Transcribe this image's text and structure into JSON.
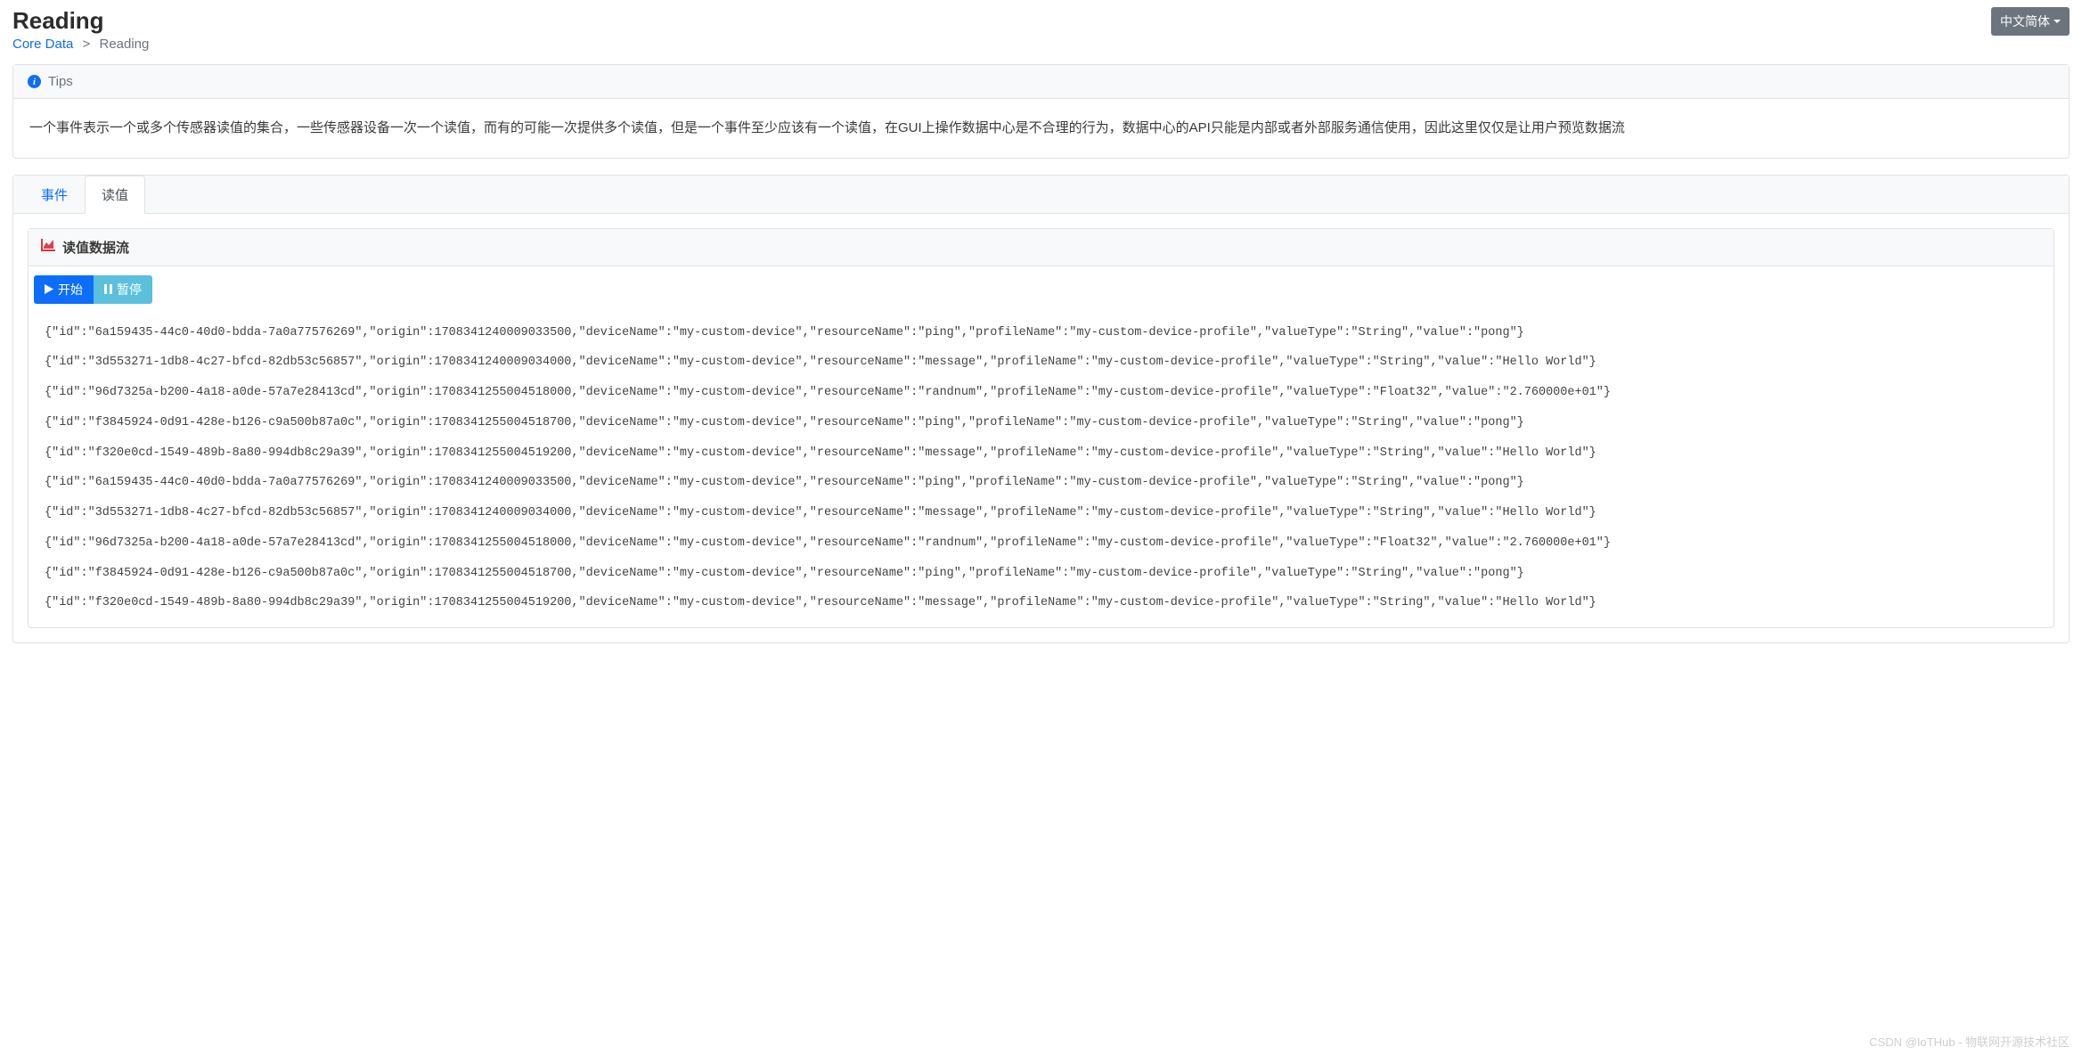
{
  "header": {
    "title": "Reading",
    "breadcrumb_root": "Core Data",
    "breadcrumb_current": "Reading",
    "lang_button": "中文简体"
  },
  "tips": {
    "label": "Tips",
    "body": "一个事件表示一个或多个传感器读值的集合，一些传感器设备一次一个读值，而有的可能一次提供多个读值，但是一个事件至少应该有一个读值，在GUI上操作数据中心是不合理的行为，数据中心的API只能是内部或者外部服务通信使用，因此这里仅仅是让用户预览数据流"
  },
  "tabs": {
    "event": "事件",
    "reading": "读值"
  },
  "panel": {
    "title": "读值数据流",
    "start": "开始",
    "pause": "暂停"
  },
  "stream": [
    "{\"id\":\"6a159435-44c0-40d0-bdda-7a0a77576269\",\"origin\":1708341240009033500,\"deviceName\":\"my-custom-device\",\"resourceName\":\"ping\",\"profileName\":\"my-custom-device-profile\",\"valueType\":\"String\",\"value\":\"pong\"}",
    "{\"id\":\"3d553271-1db8-4c27-bfcd-82db53c56857\",\"origin\":1708341240009034000,\"deviceName\":\"my-custom-device\",\"resourceName\":\"message\",\"profileName\":\"my-custom-device-profile\",\"valueType\":\"String\",\"value\":\"Hello World\"}",
    "{\"id\":\"96d7325a-b200-4a18-a0de-57a7e28413cd\",\"origin\":1708341255004518000,\"deviceName\":\"my-custom-device\",\"resourceName\":\"randnum\",\"profileName\":\"my-custom-device-profile\",\"valueType\":\"Float32\",\"value\":\"2.760000e+01\"}",
    "{\"id\":\"f3845924-0d91-428e-b126-c9a500b87a0c\",\"origin\":1708341255004518700,\"deviceName\":\"my-custom-device\",\"resourceName\":\"ping\",\"profileName\":\"my-custom-device-profile\",\"valueType\":\"String\",\"value\":\"pong\"}",
    "{\"id\":\"f320e0cd-1549-489b-8a80-994db8c29a39\",\"origin\":1708341255004519200,\"deviceName\":\"my-custom-device\",\"resourceName\":\"message\",\"profileName\":\"my-custom-device-profile\",\"valueType\":\"String\",\"value\":\"Hello World\"}",
    "{\"id\":\"6a159435-44c0-40d0-bdda-7a0a77576269\",\"origin\":1708341240009033500,\"deviceName\":\"my-custom-device\",\"resourceName\":\"ping\",\"profileName\":\"my-custom-device-profile\",\"valueType\":\"String\",\"value\":\"pong\"}",
    "{\"id\":\"3d553271-1db8-4c27-bfcd-82db53c56857\",\"origin\":1708341240009034000,\"deviceName\":\"my-custom-device\",\"resourceName\":\"message\",\"profileName\":\"my-custom-device-profile\",\"valueType\":\"String\",\"value\":\"Hello World\"}",
    "{\"id\":\"96d7325a-b200-4a18-a0de-57a7e28413cd\",\"origin\":1708341255004518000,\"deviceName\":\"my-custom-device\",\"resourceName\":\"randnum\",\"profileName\":\"my-custom-device-profile\",\"valueType\":\"Float32\",\"value\":\"2.760000e+01\"}",
    "{\"id\":\"f3845924-0d91-428e-b126-c9a500b87a0c\",\"origin\":1708341255004518700,\"deviceName\":\"my-custom-device\",\"resourceName\":\"ping\",\"profileName\":\"my-custom-device-profile\",\"valueType\":\"String\",\"value\":\"pong\"}",
    "{\"id\":\"f320e0cd-1549-489b-8a80-994db8c29a39\",\"origin\":1708341255004519200,\"deviceName\":\"my-custom-device\",\"resourceName\":\"message\",\"profileName\":\"my-custom-device-profile\",\"valueType\":\"String\",\"value\":\"Hello World\"}"
  ],
  "watermark": "CSDN @IoTHub - 物联网开源技术社区"
}
